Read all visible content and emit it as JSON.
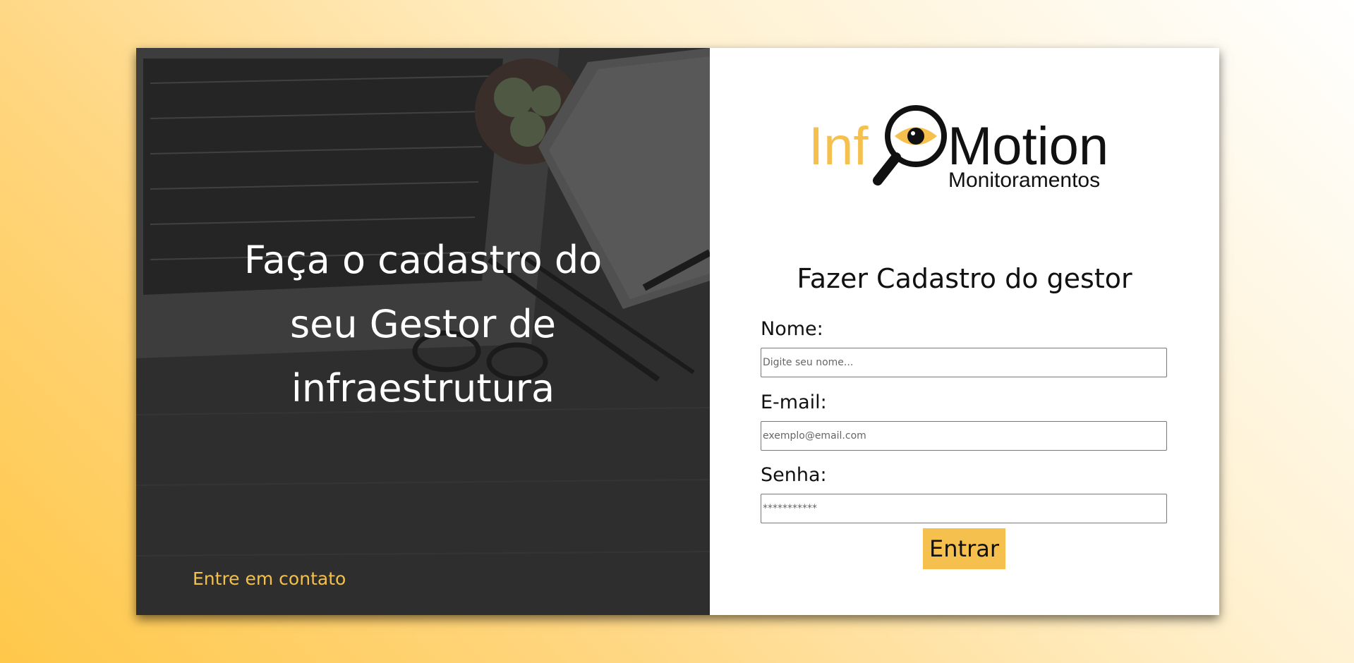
{
  "hero": {
    "lines": [
      "Faça o cadastro do",
      "seu Gestor de",
      "infraestrutura"
    ],
    "contact_link": "Entre em contato"
  },
  "brand": {
    "name_part1": "Inf",
    "name_part2": "Motion",
    "subtitle": "Monitoramentos",
    "accent_color": "#f6c04f",
    "text_color": "#111111"
  },
  "form": {
    "title": "Fazer Cadastro do gestor",
    "fields": [
      {
        "label": "Nome:",
        "placeholder": "Digite seu nome..."
      },
      {
        "label": "E-mail:",
        "placeholder": "exemplo@email.com"
      },
      {
        "label": "Senha:",
        "placeholder": "***********"
      }
    ],
    "submit_label": "Entrar"
  },
  "colors": {
    "accent": "#f6c04f",
    "background_gradient_start": "#ffc84a"
  }
}
